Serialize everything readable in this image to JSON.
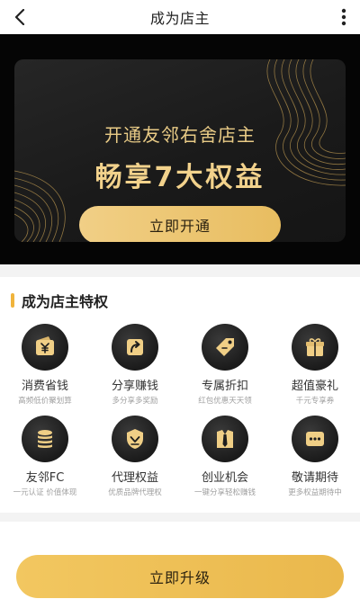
{
  "header": {
    "title": "成为店主",
    "back_icon": "chevron-left-icon",
    "more_icon": "more-vertical-icon"
  },
  "hero": {
    "subtitle": "开通友邻右舍店主",
    "title": "畅享7大权益",
    "button_label": "立即开通"
  },
  "privileges": {
    "title": "成为店主特权",
    "items": [
      {
        "label": "消费省钱",
        "desc": "高频低价聚划算",
        "icon": "wallet-yen-icon"
      },
      {
        "label": "分享赚钱",
        "desc": "多分享多奖励",
        "icon": "share-icon"
      },
      {
        "label": "专属折扣",
        "desc": "红包优惠天天领",
        "icon": "tag-icon"
      },
      {
        "label": "超值豪礼",
        "desc": "千元专享券",
        "icon": "gift-icon"
      },
      {
        "label": "友邻FC",
        "desc": "一元认证 价值体现",
        "icon": "coin-stack-icon"
      },
      {
        "label": "代理权益",
        "desc": "优质品牌代理权",
        "icon": "badge-icon"
      },
      {
        "label": "创业机会",
        "desc": "一键分享轻松赚钱",
        "icon": "suit-tie-icon"
      },
      {
        "label": "敬请期待",
        "desc": "更多权益期待中",
        "icon": "more-box-icon"
      }
    ]
  },
  "footer": {
    "button_label": "立即升级"
  },
  "colors": {
    "gold": "#f2d28c",
    "button_gold": "#eab84c",
    "dark": "#1a1a1a"
  }
}
